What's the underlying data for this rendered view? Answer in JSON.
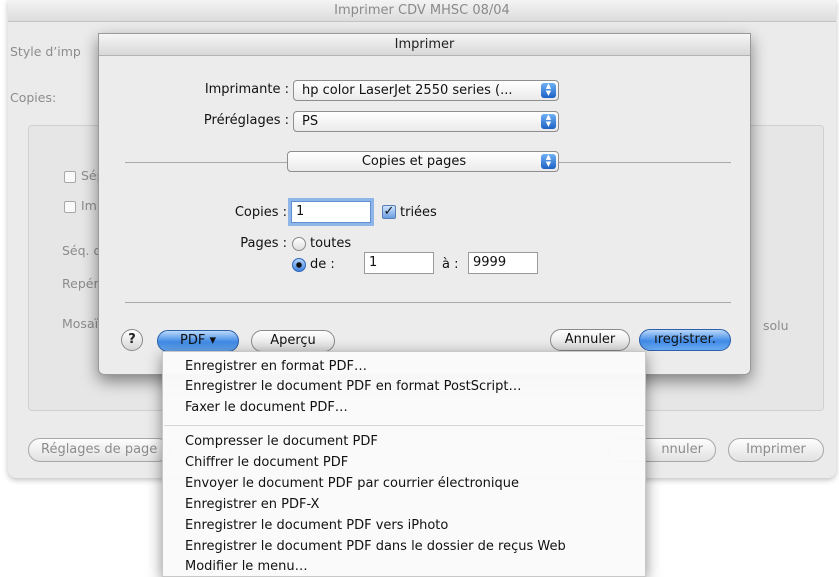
{
  "background_window": {
    "title": "Imprimer CDV MHSC 08/04",
    "style_label": "Style d’imp",
    "copies_label": "Copies:",
    "checkbox_1": "Sép",
    "checkbox_2": "Im",
    "seq_label": "Séq. d",
    "repere_label": "Repér",
    "mosaic_label": "Mosaï",
    "solu_fragment": "solu",
    "buttons": {
      "page_setup": "Réglages de page",
      "cancel": "nnuler",
      "print": "Imprimer"
    }
  },
  "dialog": {
    "title": "Imprimer",
    "printer_label": "Imprimante :",
    "printer_value": "hp color LaserJet 2550 series (...",
    "presets_label": "Préréglages :",
    "presets_value": "PS",
    "panel_value": "Copies et pages",
    "copies_label": "Copies :",
    "copies_value": "1",
    "collated_label": "triées",
    "collated_checked": true,
    "pages_label": "Pages :",
    "pages_all_label": "toutes",
    "pages_from_label": "de :",
    "pages_from_value": "1",
    "pages_to_label": "à :",
    "pages_to_value": "9999",
    "pages_mode": "range",
    "buttons": {
      "help": "?",
      "pdf": "PDF ▾",
      "preview": "Aperçu",
      "cancel": "Annuler",
      "save": "ıregistrer."
    }
  },
  "pdf_menu": {
    "group1": [
      "Enregistrer en format PDF…",
      "Enregistrer le document PDF en format PostScript…",
      "Faxer le document PDF…"
    ],
    "group2": [
      "Compresser le document PDF",
      "Chiffrer le document PDF",
      "Envoyer le document PDF par courrier électronique",
      "Enregistrer en PDF-X",
      "Enregistrer le document PDF vers iPhoto",
      "Enregistrer le document PDF dans le dossier de reçus Web",
      "Modifier le menu…"
    ]
  },
  "colors": {
    "accent_blue": "#3f8ae6",
    "window_bg": "#ececec",
    "focus_ring": "#8fb6e8"
  },
  "icons": {
    "popup_arrows": "up-down-arrows-icon",
    "help": "question-mark-icon",
    "checkbox_check": "checkmark-icon"
  }
}
